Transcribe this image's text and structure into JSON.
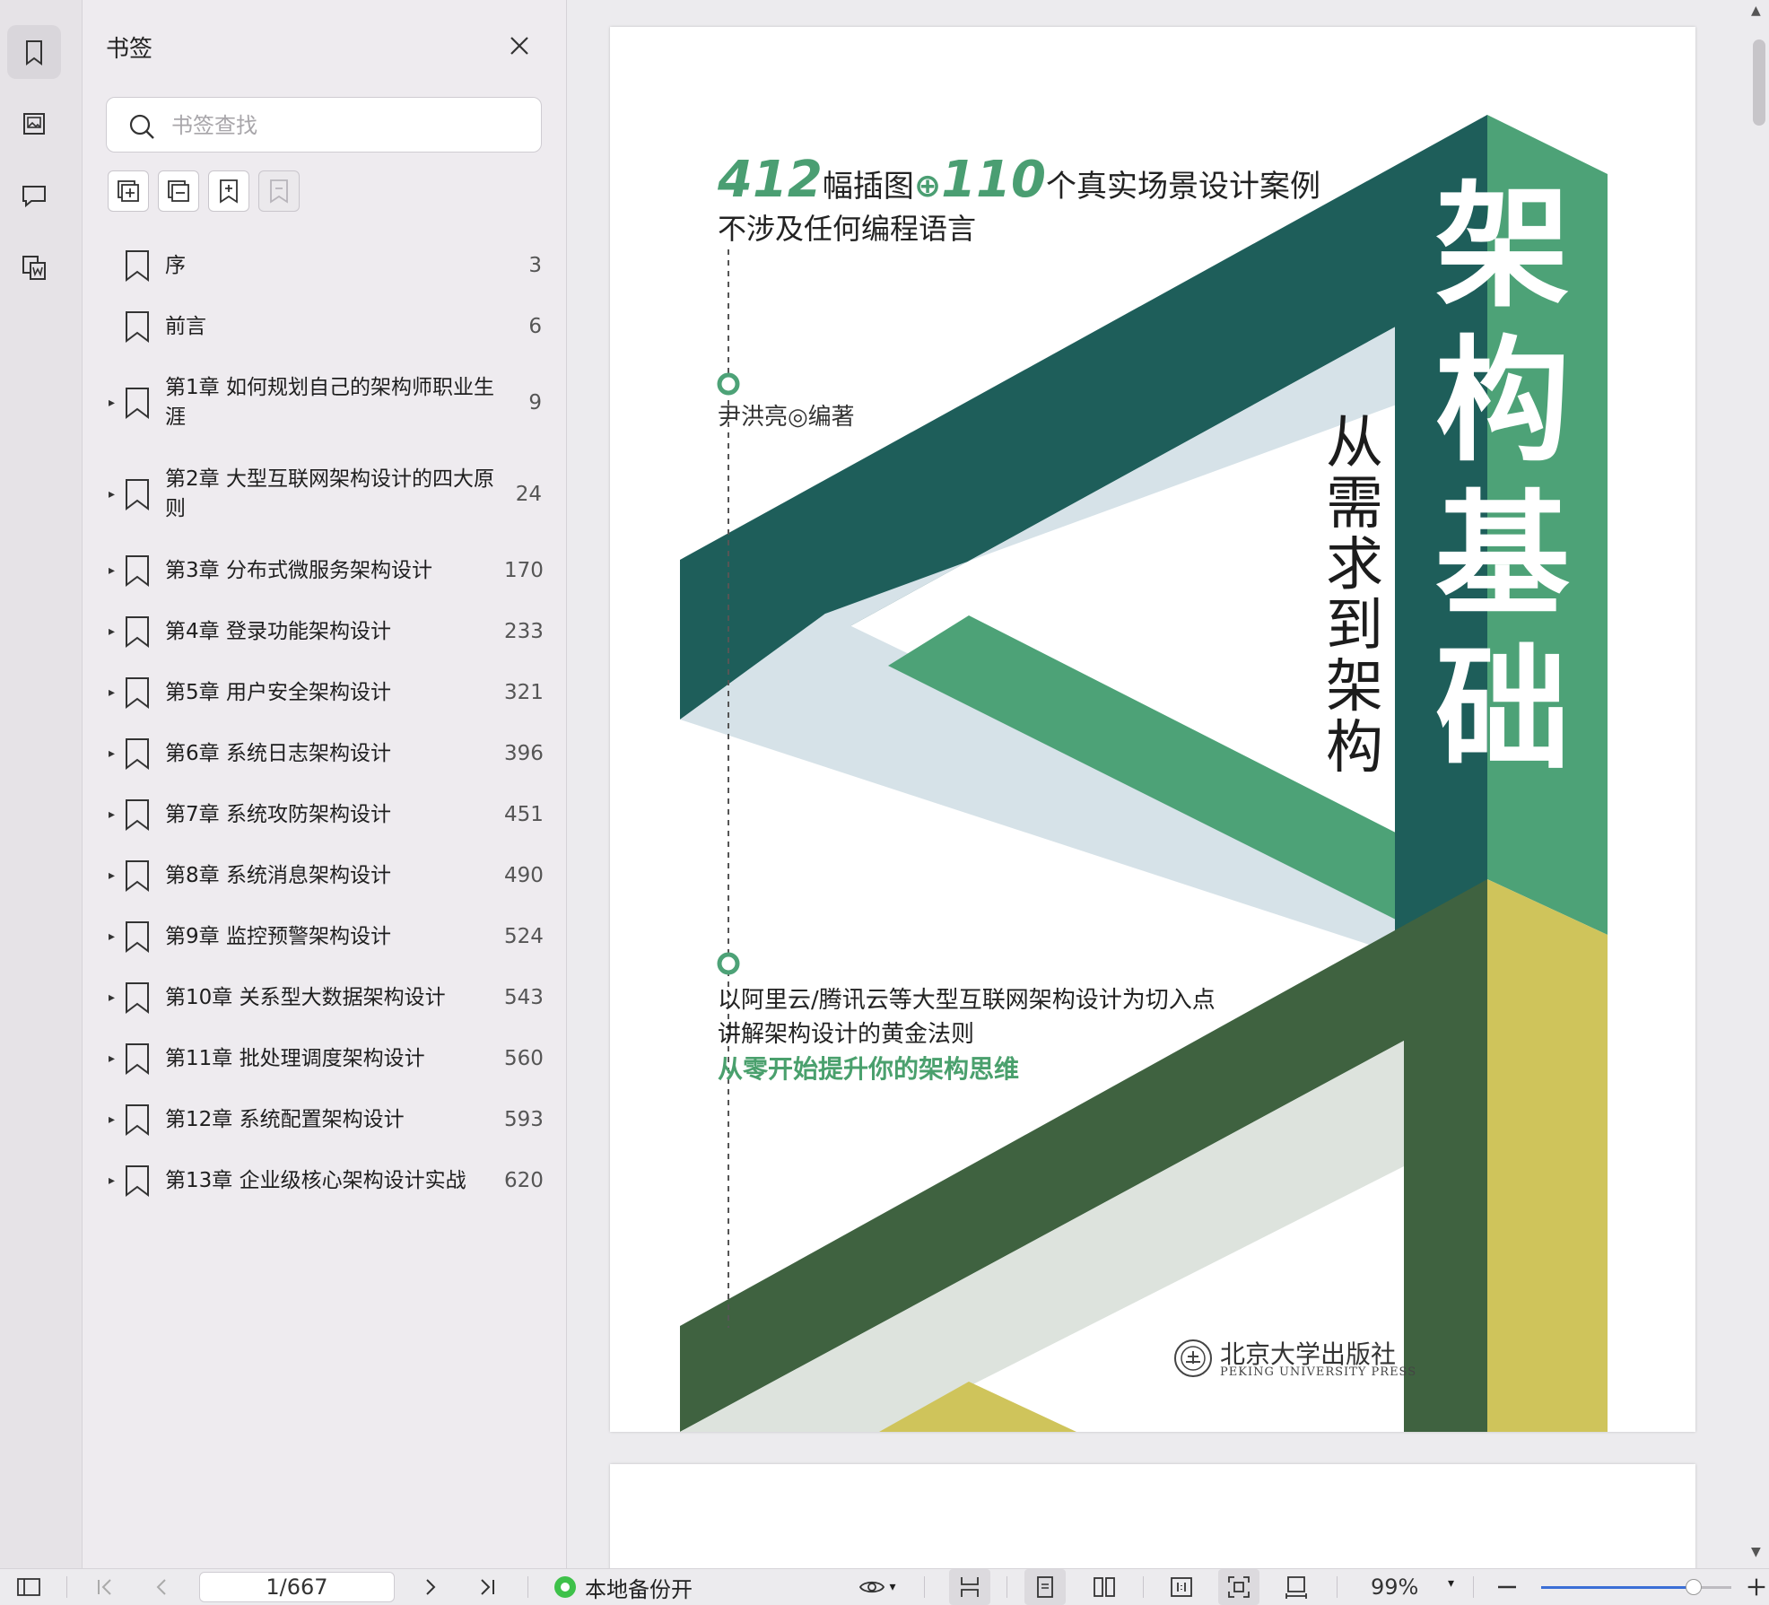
{
  "panel": {
    "title": "书签",
    "search_placeholder": "书签查找"
  },
  "bookmarks": [
    {
      "label": "序",
      "page": "3",
      "expandable": false
    },
    {
      "label": "前言",
      "page": "6",
      "expandable": false
    },
    {
      "label": "第1章 如何规划自己的架构师职业生涯",
      "page": "9",
      "expandable": true
    },
    {
      "label": "第2章 大型互联网架构设计的四大原则",
      "page": "24",
      "expandable": true
    },
    {
      "label": "第3章 分布式微服务架构设计",
      "page": "170",
      "expandable": true
    },
    {
      "label": "第4章 登录功能架构设计",
      "page": "233",
      "expandable": true
    },
    {
      "label": "第5章 用户安全架构设计",
      "page": "321",
      "expandable": true
    },
    {
      "label": "第6章 系统日志架构设计",
      "page": "396",
      "expandable": true
    },
    {
      "label": "第7章 系统攻防架构设计",
      "page": "451",
      "expandable": true
    },
    {
      "label": "第8章 系统消息架构设计",
      "page": "490",
      "expandable": true
    },
    {
      "label": "第9章 监控预警架构设计",
      "page": "524",
      "expandable": true
    },
    {
      "label": "第10章 关系型大数据架构设计",
      "page": "543",
      "expandable": true
    },
    {
      "label": "第11章 批处理调度架构设计",
      "page": "560",
      "expandable": true
    },
    {
      "label": "第12章 系统配置架构设计",
      "page": "593",
      "expandable": true
    },
    {
      "label": "第13章 企业级核心架构设计实战",
      "page": "620",
      "expandable": true
    }
  ],
  "cover": {
    "stat1_num": "412",
    "stat1_text": "幅插图",
    "stat_plus": "⊕",
    "stat2_num": "110",
    "stat2_text": "个真实场景设计案例",
    "line2": "不涉及任何编程语言",
    "author": "尹洪亮◎编著",
    "desc1": "以阿里云/腾讯云等大型互联网架构设计为切入点",
    "desc2": "讲解架构设计的黄金法则",
    "desc3": "从零开始提升你的架构思维",
    "title": "架构基础",
    "subtitle": "从需求到架构",
    "publisher_cn": "北京大学出版社",
    "publisher_en": "PEKING UNIVERSITY PRESS"
  },
  "toolbar": {
    "page_indicator": "1/667",
    "backup_label": "本地备份开",
    "zoom": "99%",
    "zoom_fraction": 0.8
  },
  "colors": {
    "dark_teal": "#1e5e5a",
    "green": "#4da277",
    "dark_green": "#3f6240",
    "pale_blue": "#d6e2e8",
    "pale_grey": "#dde3dd",
    "yellow": "#cfc45b"
  }
}
